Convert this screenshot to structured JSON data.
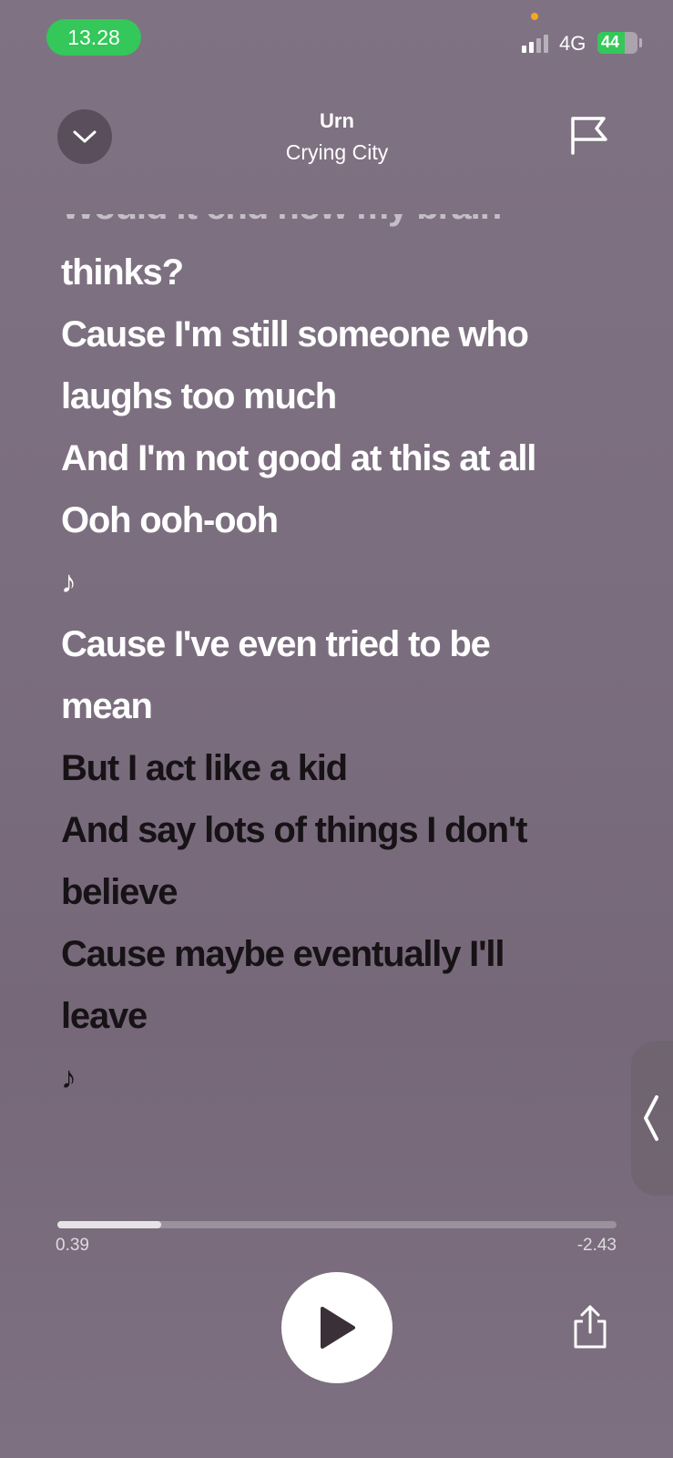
{
  "status_bar": {
    "time": "13.28",
    "network": "4G",
    "battery": "44"
  },
  "header": {
    "song_title": "Urn",
    "artist": "Crying City"
  },
  "lyrics": {
    "faded_line": "Would it end how my brain",
    "lines": [
      {
        "text": "thinks?",
        "state": "past"
      },
      {
        "text": "Cause I'm still someone who",
        "state": "past"
      },
      {
        "text": "laughs too much",
        "state": "past"
      },
      {
        "text": "And I'm not good at this at all",
        "state": "past"
      },
      {
        "text": "Ooh ooh-ooh",
        "state": "past"
      },
      {
        "text": "♪",
        "state": "past"
      },
      {
        "text": "Cause I've even tried to be",
        "state": "past"
      },
      {
        "text": "mean",
        "state": "past"
      },
      {
        "text": "But I act like a kid",
        "state": "upcoming"
      },
      {
        "text": "And say lots of things I don't",
        "state": "upcoming"
      },
      {
        "text": "believe",
        "state": "upcoming"
      },
      {
        "text": "Cause maybe eventually I'll",
        "state": "upcoming"
      },
      {
        "text": "leave",
        "state": "upcoming"
      },
      {
        "text": "♪",
        "state": "upcoming"
      }
    ]
  },
  "playback": {
    "elapsed": "0.39",
    "remaining": "-2.43",
    "progress_fraction": 0.185
  },
  "icons": {
    "collapse": "chevron-down-icon",
    "report": "flag-icon",
    "play": "play-icon",
    "share": "share-icon",
    "side_tab": "chevron-left-icon"
  },
  "colors": {
    "time_pill": "#34c759",
    "past_lyric": "#ffffff",
    "upcoming_lyric": "#161216"
  }
}
